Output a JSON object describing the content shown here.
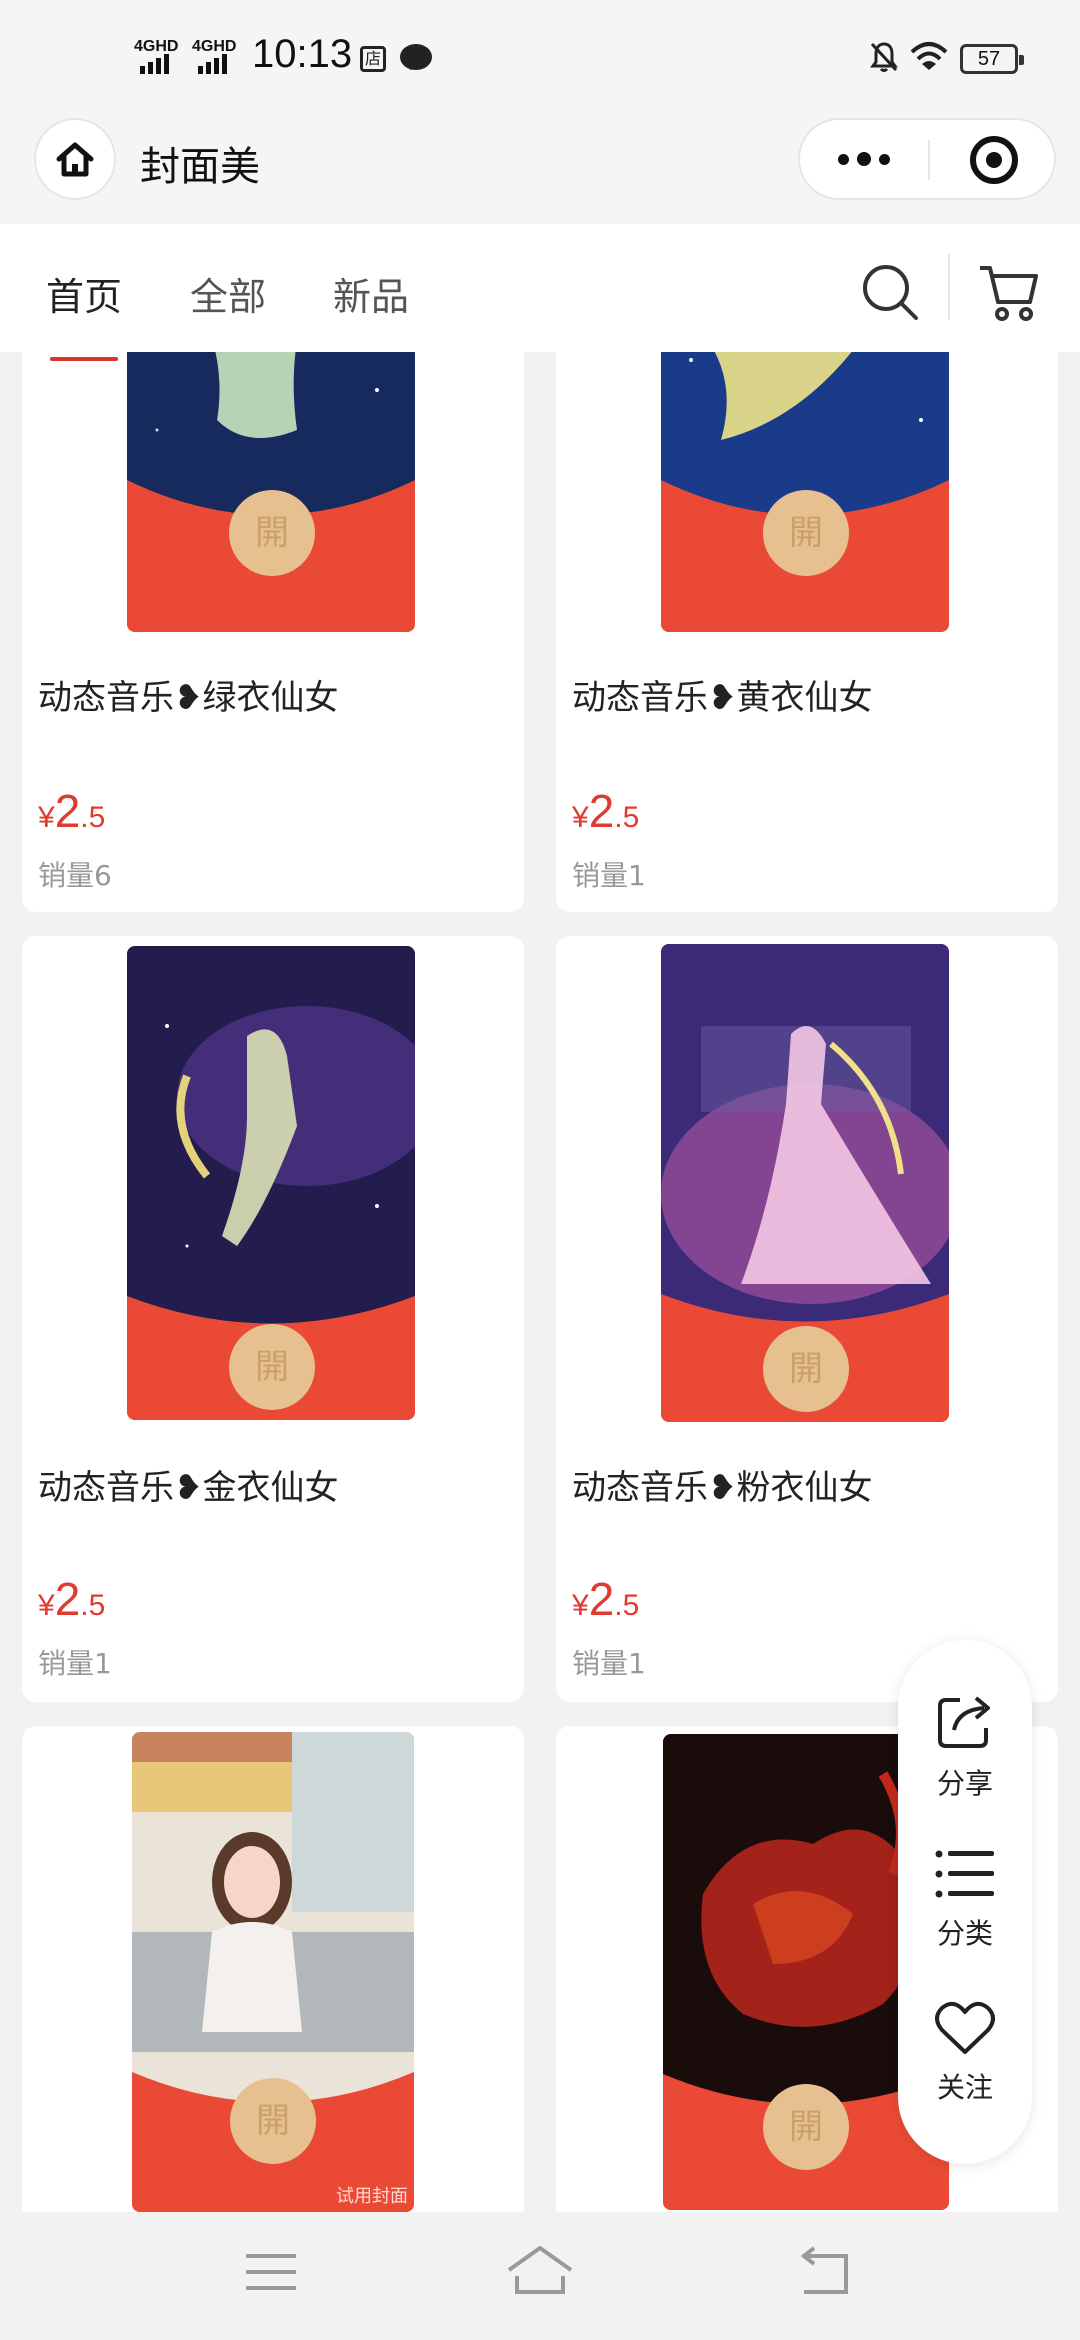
{
  "status_bar": {
    "network_1": "4GHD",
    "network_2": "4GHD",
    "time": "10:13",
    "shop_glyph": "店",
    "battery": "57"
  },
  "header": {
    "title": "封面美"
  },
  "nav": {
    "tabs": [
      {
        "label": "首页",
        "active": true
      },
      {
        "label": "全部",
        "active": false
      },
      {
        "label": "新品",
        "active": false
      }
    ]
  },
  "seal_glyph": "開",
  "products": [
    {
      "name": "动态音乐❥绿衣仙女",
      "price_currency": "¥",
      "price_int": "2",
      "price_dec": ".5",
      "sales": "销量6"
    },
    {
      "name": "动态音乐❥黄衣仙女",
      "price_currency": "¥",
      "price_int": "2",
      "price_dec": ".5",
      "sales": "销量1"
    },
    {
      "name": "动态音乐❥金衣仙女",
      "price_currency": "¥",
      "price_int": "2",
      "price_dec": ".5",
      "sales": "销量1"
    },
    {
      "name": "动态音乐❥粉衣仙女",
      "price_currency": "¥",
      "price_int": "2",
      "price_dec": ".5",
      "sales": "销量1"
    },
    {
      "trial_label": "试用封面"
    },
    {}
  ],
  "float_actions": {
    "share": "分享",
    "category": "分类",
    "follow": "关注"
  },
  "colors": {
    "accent_red": "#e23a2e",
    "cover_red": "#ea4a35",
    "seal_gold": "#e6c18f"
  }
}
